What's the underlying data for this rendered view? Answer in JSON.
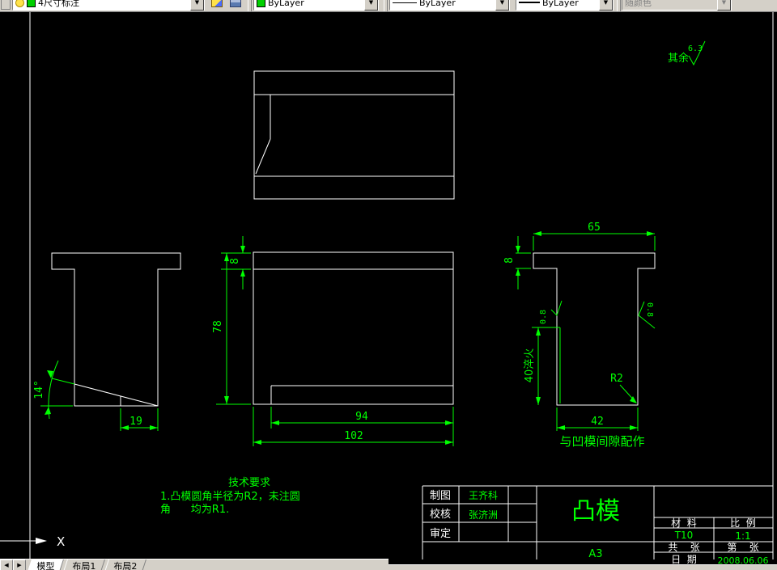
{
  "colors": {
    "cad_green": "#00ff00",
    "cad_white": "#ffffff",
    "background": "#000000",
    "chrome_gray": "#d4d0c8",
    "layer_swatch_green": "#00d000"
  },
  "toolbar": {
    "layer_value": "4尺寸标注",
    "color_value": "ByLayer",
    "linetype_value": "ByLayer",
    "lineweight_value": "ByLayer",
    "plotstyle_value": "随颜色",
    "dropdown_arrow": "▼"
  },
  "canvas": {
    "surface_note": {
      "prefix": "其余",
      "value": "6.3"
    },
    "dims": {
      "side_angle": "14°",
      "side_step": "19",
      "front_top": "8",
      "front_height": "78",
      "front_inner": "94",
      "front_outer": "102",
      "right_flange": "65",
      "right_top": "8",
      "right_hardening": "40淬火",
      "right_radius": "R2",
      "right_bottom": "42",
      "rough_left": "0.8",
      "rough_right": "0.8"
    },
    "fit_note": "与凹模间隙配作",
    "tech": {
      "title": "技术要求",
      "line1": "1.凸模圆角半径为R2，未注圆",
      "line2": "角      均为R1."
    },
    "ucs_x": "X"
  },
  "title_block": {
    "drawn_label": "制图",
    "drawn_value": "王齐科",
    "checked_label": "校核",
    "checked_value": "张济洲",
    "approved_label": "审定",
    "part_name": "凸模",
    "sheet_size": "A3",
    "material_label": "材  料",
    "material_value": "T10",
    "scale_label": "比  例",
    "scale_value": "1:1",
    "total_label": "共    张",
    "number_label": "第    张",
    "date_label": "日  期",
    "date_value": "2008.06.06"
  },
  "tabs": {
    "nav_back": "◀",
    "nav_fwd": "▶",
    "model": "模型",
    "layout1": "布局1",
    "layout2": "布局2"
  }
}
